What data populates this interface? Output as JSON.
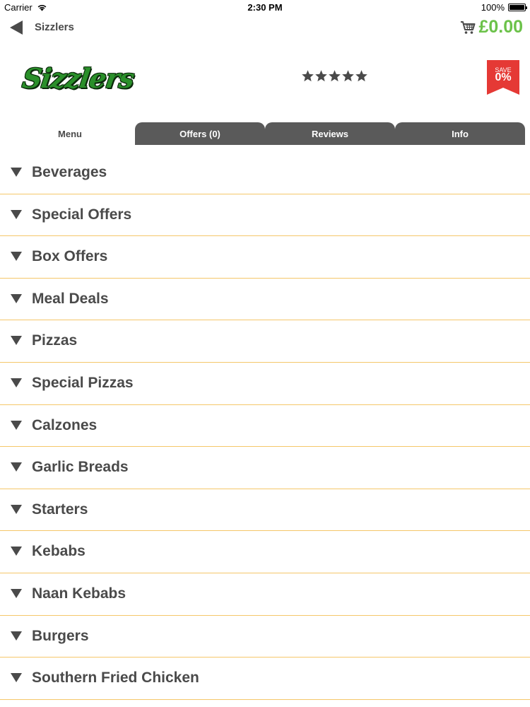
{
  "status_bar": {
    "carrier": "Carrier",
    "time": "2:30 PM",
    "battery": "100%",
    "battery_level": 1.0
  },
  "nav": {
    "title": "Sizzlers",
    "cart_total": "£0.00",
    "back_icon": "back-arrow-icon",
    "cart_icon": "shopping-cart-icon"
  },
  "header": {
    "logo_text": "Sizzlers",
    "rating_stars": 5,
    "save_label": "SAVE",
    "save_value": "0%"
  },
  "tabs": [
    {
      "label": "Menu",
      "active": true
    },
    {
      "label": "Offers (0)",
      "active": false
    },
    {
      "label": "Reviews",
      "active": false
    },
    {
      "label": "Info",
      "active": false
    }
  ],
  "menu_categories": [
    {
      "label": "Beverages"
    },
    {
      "label": "Special Offers"
    },
    {
      "label": "Box Offers"
    },
    {
      "label": "Meal Deals"
    },
    {
      "label": "Pizzas"
    },
    {
      "label": "Special Pizzas"
    },
    {
      "label": "Calzones"
    },
    {
      "label": "Garlic Breads"
    },
    {
      "label": "Starters"
    },
    {
      "label": "Kebabs"
    },
    {
      "label": "Naan Kebabs"
    },
    {
      "label": "Burgers"
    },
    {
      "label": "Southern Fried Chicken"
    }
  ],
  "colors": {
    "accent_green": "#6cc24a",
    "badge_red": "#e53935",
    "separator": "#f5c76a",
    "tab_inactive": "#5a5a5a",
    "text": "#4a4a4a"
  }
}
